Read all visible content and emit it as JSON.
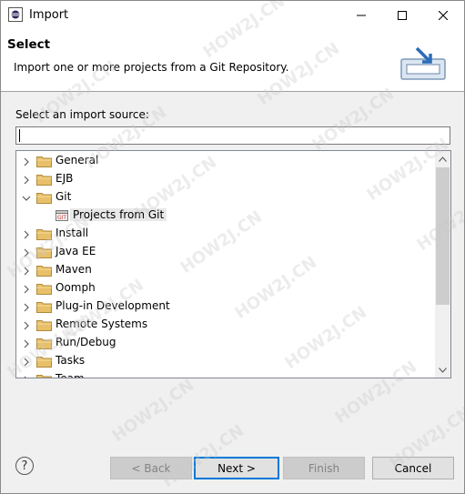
{
  "window": {
    "title": "Import",
    "minimize_glyph": "—",
    "close_glyph": "✕"
  },
  "banner": {
    "title": "Select",
    "description": "Import one or more projects from a Git Repository."
  },
  "source": {
    "label": "Select an import source:",
    "filter_value": ""
  },
  "tree": {
    "items": [
      {
        "label": "General",
        "expanded": false
      },
      {
        "label": "EJB",
        "expanded": false
      },
      {
        "label": "Git",
        "expanded": true
      },
      {
        "label": "Projects from Git",
        "child": true,
        "selected": true
      },
      {
        "label": "Install",
        "expanded": false
      },
      {
        "label": "Java EE",
        "expanded": false
      },
      {
        "label": "Maven",
        "expanded": false
      },
      {
        "label": "Oomph",
        "expanded": false
      },
      {
        "label": "Plug-in Development",
        "expanded": false
      },
      {
        "label": "Remote Systems",
        "expanded": false
      },
      {
        "label": "Run/Debug",
        "expanded": false
      },
      {
        "label": "Tasks",
        "expanded": false
      },
      {
        "label": "Team",
        "expanded": false
      }
    ]
  },
  "footer": {
    "help_glyph": "?",
    "back_label": "< Back",
    "next_label": "Next >",
    "finish_label": "Finish",
    "cancel_label": "Cancel"
  },
  "watermark_text": "HOW2J.CN",
  "colors": {
    "default_button_border": "#0078d7",
    "folder_fill": "#e8c06a",
    "selection": "#e8e8e8"
  }
}
